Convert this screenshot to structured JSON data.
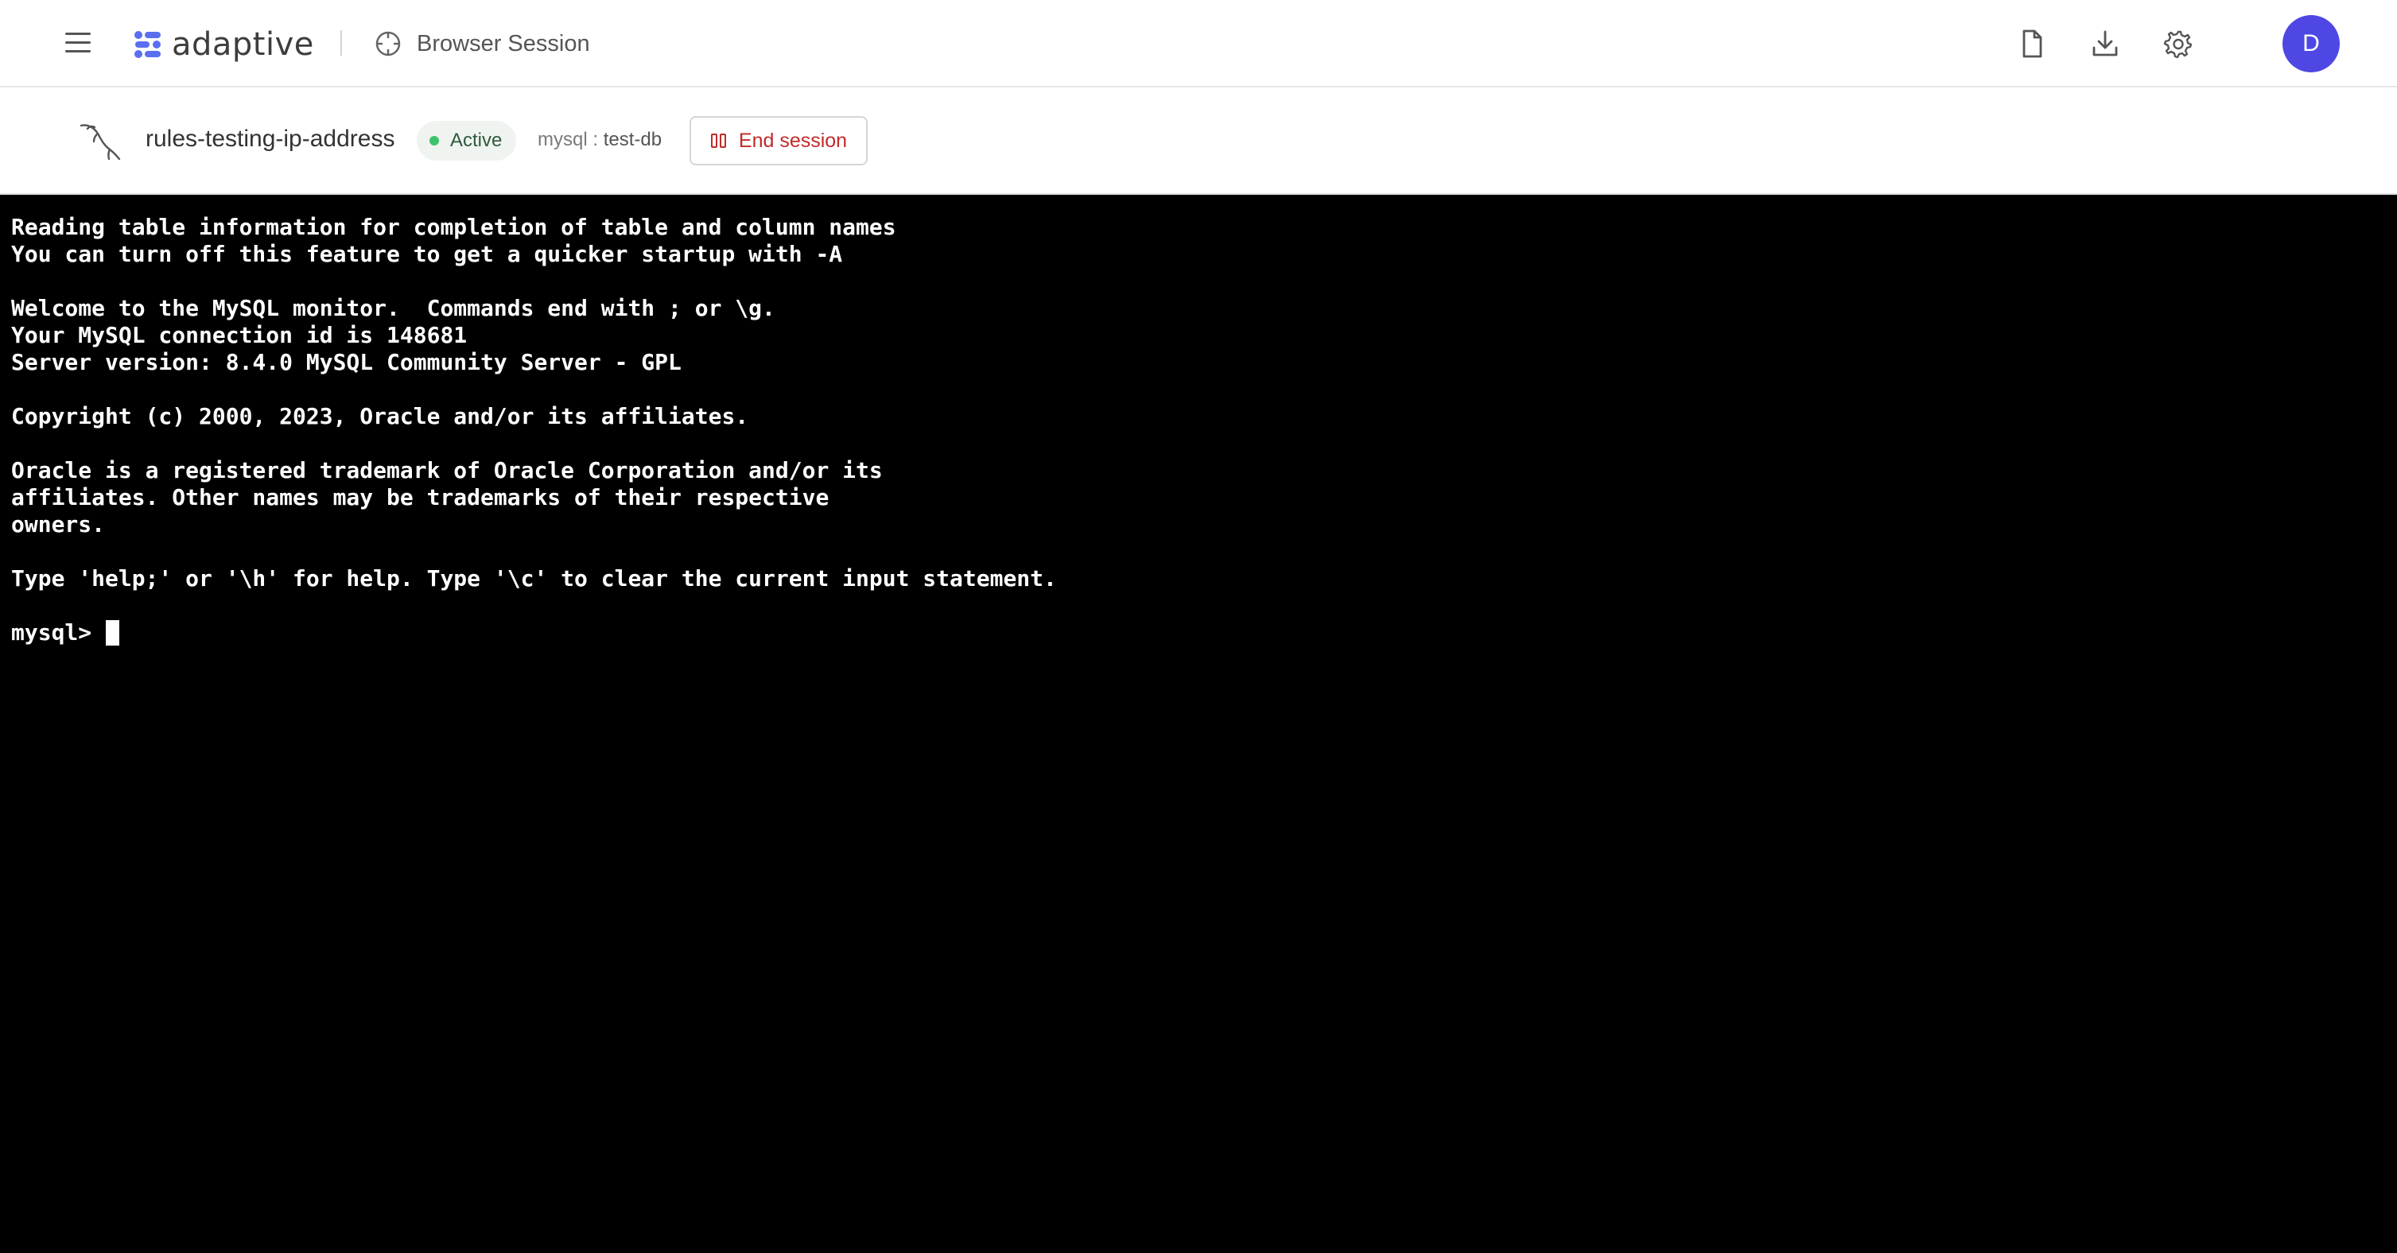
{
  "header": {
    "brand": "adaptive",
    "session_title": "Browser Session",
    "avatar_initial": "D",
    "icons": [
      "menu-icon",
      "document-icon",
      "download-icon",
      "settings-gear-icon"
    ]
  },
  "session": {
    "connection_name": "rules-testing-ip-address",
    "status": "Active",
    "db_type": "mysql",
    "db_separator": " : ",
    "db_name": "test-db",
    "end_button_label": "End session"
  },
  "terminal": {
    "lines": [
      "Reading table information for completion of table and column names",
      "You can turn off this feature to get a quicker startup with -A",
      "",
      "Welcome to the MySQL monitor.  Commands end with ; or \\g.",
      "Your MySQL connection id is 148681",
      "Server version: 8.4.0 MySQL Community Server - GPL",
      "",
      "Copyright (c) 2000, 2023, Oracle and/or its affiliates.",
      "",
      "Oracle is a registered trademark of Oracle Corporation and/or its",
      "affiliates. Other names may be trademarks of their respective",
      "owners.",
      "",
      "Type 'help;' or '\\h' for help. Type '\\c' to clear the current input statement.",
      ""
    ],
    "prompt": "mysql>"
  },
  "colors": {
    "avatar": "#4f47e3",
    "status_dot": "#3cc36c",
    "end_session": "#c22a2a",
    "logo_accent": "#5a6ff0"
  }
}
